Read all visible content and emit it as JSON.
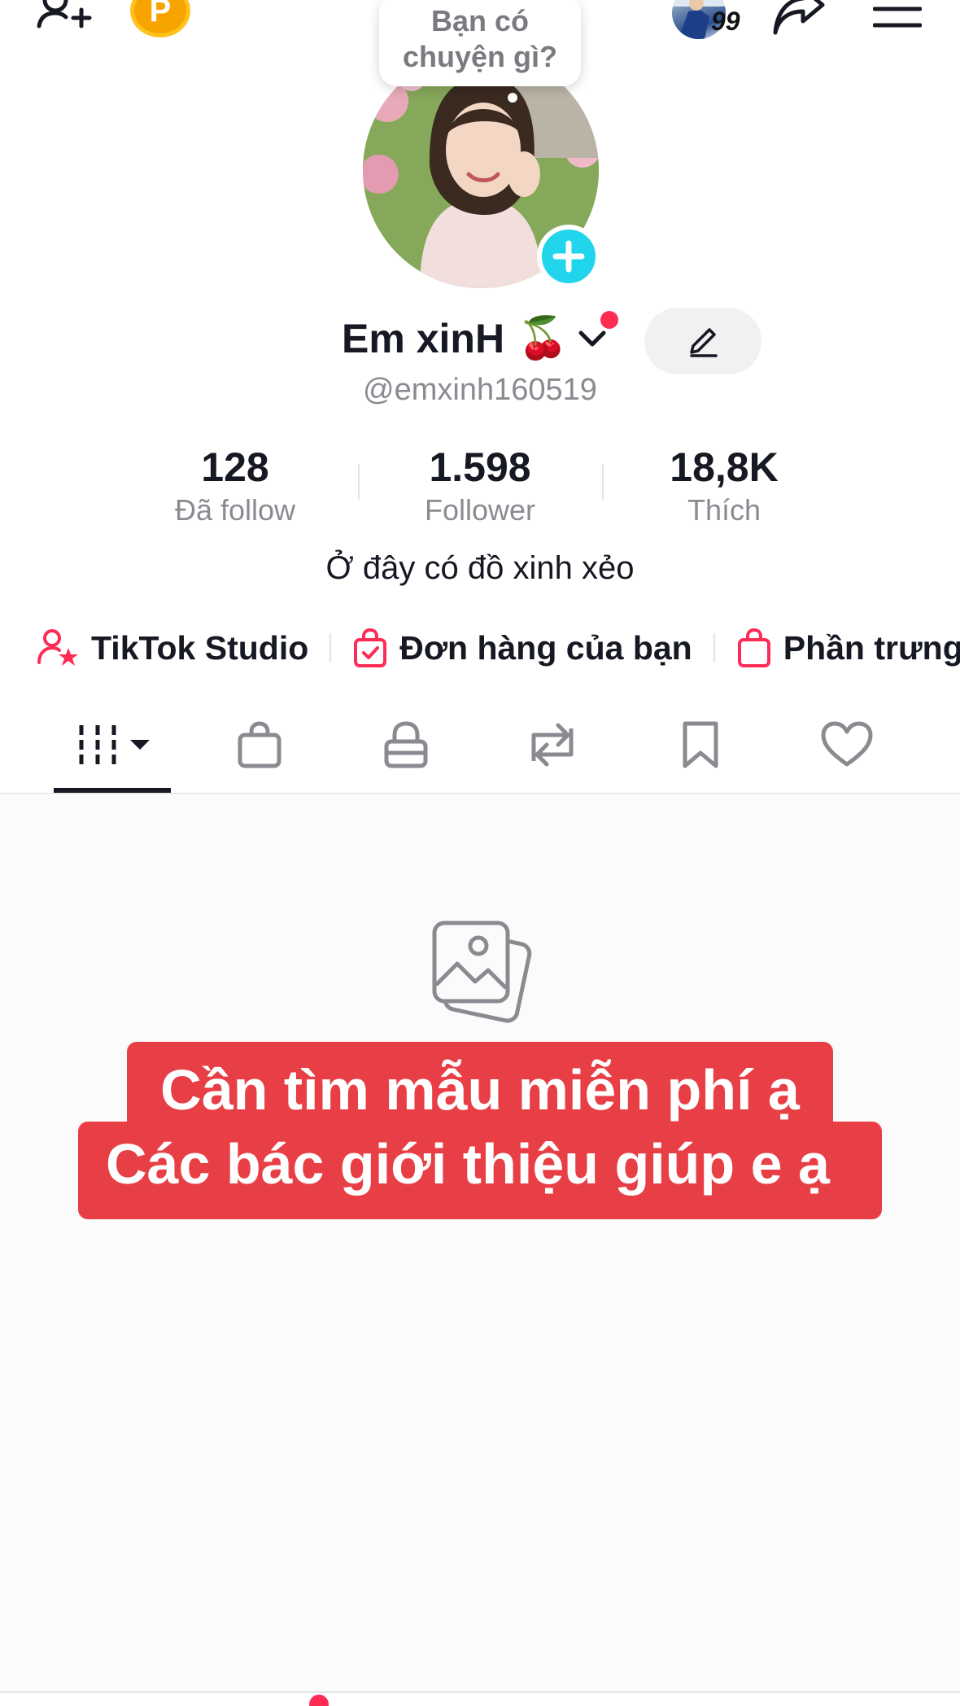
{
  "top_bar": {
    "points_badge_letter": "P",
    "friend_count": "99"
  },
  "bubble": {
    "line1": "Bạn có",
    "line2": "chuyện gì?"
  },
  "profile": {
    "name": "Em xinH",
    "name_emoji": "🍒",
    "handle": "@emxinh160519",
    "bio": "Ở đây có đồ xinh xẻo"
  },
  "stats": [
    {
      "value": "128",
      "label": "Đã follow"
    },
    {
      "value": "1.598",
      "label": "Follower"
    },
    {
      "value": "18,8K",
      "label": "Thích"
    }
  ],
  "links": [
    {
      "label": "TikTok Studio",
      "icon": "person-star-icon"
    },
    {
      "label": "Đơn hàng của bạn",
      "icon": "bag-check-icon"
    },
    {
      "label": "Phần trưng",
      "icon": "shopping-bag-icon"
    }
  ],
  "tabs": [
    "videos-grid-icon",
    "shop-bag-icon",
    "lock-icon",
    "repost-icon",
    "bookmark-icon",
    "heart-icon"
  ],
  "banner": {
    "line1": "Cần tìm mẫu miễn phí ạ",
    "line2": "Các bác giới thiệu giúp e ạ"
  },
  "colors": {
    "accent": "#fe2c55",
    "add_button": "#20d5ec",
    "banner_bg": "#e83e45",
    "text_primary": "#161823",
    "text_secondary": "#8a8b91"
  }
}
